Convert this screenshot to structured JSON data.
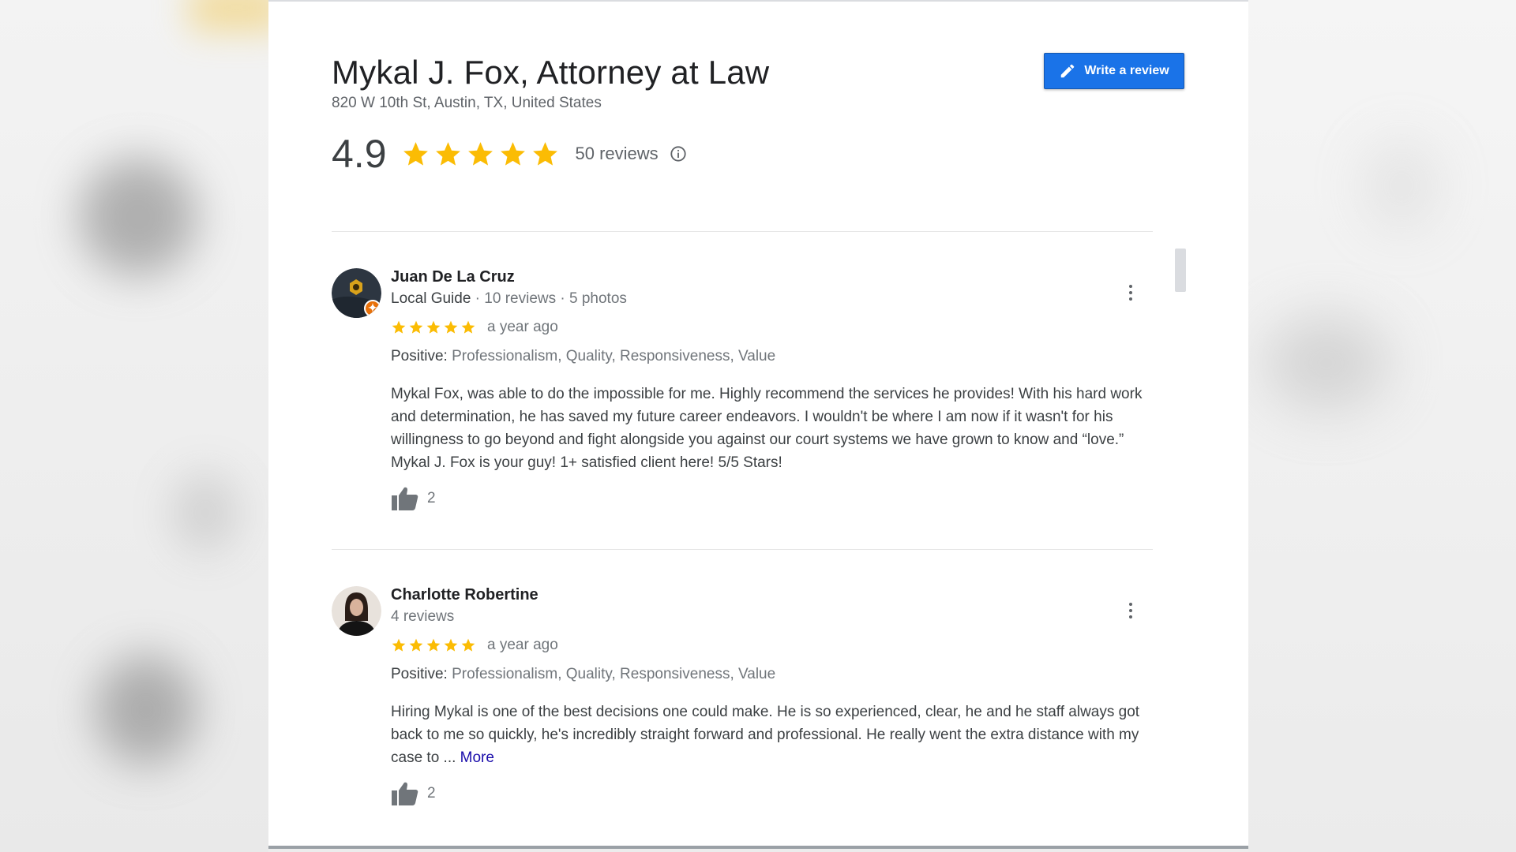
{
  "business": {
    "name": "Mykal J. Fox, Attorney at Law",
    "address": "820 W 10th St, Austin, TX, United States",
    "rating": "4.9",
    "stars": 5,
    "reviews_count": "50 reviews",
    "write_review_label": "Write a review"
  },
  "colors": {
    "star": "#fbbc04",
    "button": "#1a73e8",
    "link": "#1a0dab"
  },
  "icons": {
    "write": "pencil-icon",
    "info": "info-icon",
    "menu": "more-vert-icon",
    "like": "thumbs-up-icon"
  },
  "reviews": [
    {
      "name": "Juan De La Cruz",
      "guide": "Local Guide",
      "meta_rest": " · 10 reviews · 5 photos",
      "stars": 5,
      "time": "a year ago",
      "positive_label": "Positive:",
      "positive_values": "Professionalism, Quality, Responsiveness, Value",
      "text": "Mykal Fox, was able to do the impossible for me. Highly recommend the services he provides! With his hard work and determination, he has saved my future career endeavors. I wouldn't be where I am now if it wasn't for his willingness to go beyond and fight alongside you against our court systems we have grown to know and “love.” Mykal J. Fox is your guy! 1+ satisfied client here! 5/5 Stars!",
      "likes": "2"
    },
    {
      "name": "Charlotte Robertine",
      "meta": "4 reviews",
      "stars": 5,
      "time": "a year ago",
      "positive_label": "Positive:",
      "positive_values": "Professionalism, Quality, Responsiveness, Value",
      "text": "Hiring Mykal is one of the best decisions one could make. He is so experienced, clear, he and he staff always got back to me so quickly, he's incredibly straight forward and professional. He really went the extra distance with my case to ...",
      "more_label": "More",
      "likes": "2"
    }
  ]
}
